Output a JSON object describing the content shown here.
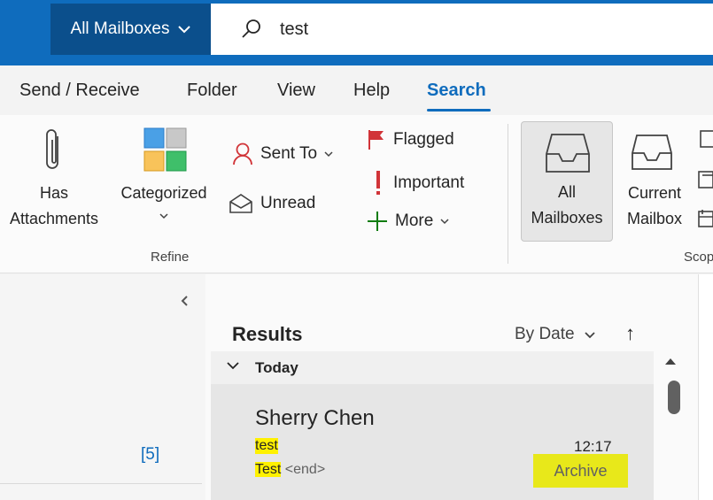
{
  "topbar": {
    "scope_label": "All Mailboxes",
    "search_value": "test"
  },
  "tabs": [
    "Send / Receive",
    "Folder",
    "View",
    "Help",
    "Search"
  ],
  "ribbon": {
    "has_attachments": [
      "Has",
      "Attachments"
    ],
    "categorized": "Categorized",
    "sent_to": "Sent To",
    "unread": "Unread",
    "flagged": "Flagged",
    "important": "Important",
    "more": "More",
    "refine_group": "Refine",
    "all_mailboxes": [
      "All",
      "Mailboxes"
    ],
    "current_mailbox": [
      "Current",
      "Mailbox"
    ],
    "scope_group": "Scop"
  },
  "folder_pane": {
    "unread_count": "[5]"
  },
  "results": {
    "title": "Results",
    "sort_label": "By Date",
    "sort_dir": "↑",
    "group_label": "Today",
    "message": {
      "sender": "Sherry Chen",
      "subject": "test",
      "preview_hl": "Test",
      "preview_tail": " <end>",
      "time": "12:17",
      "folder": "Archive"
    }
  },
  "colors": {
    "accent": "#0f6cbd",
    "topbar": "#0f6cbd",
    "highlight": "#fff100",
    "flag": "#d13438",
    "more_plus": "#107c10"
  }
}
